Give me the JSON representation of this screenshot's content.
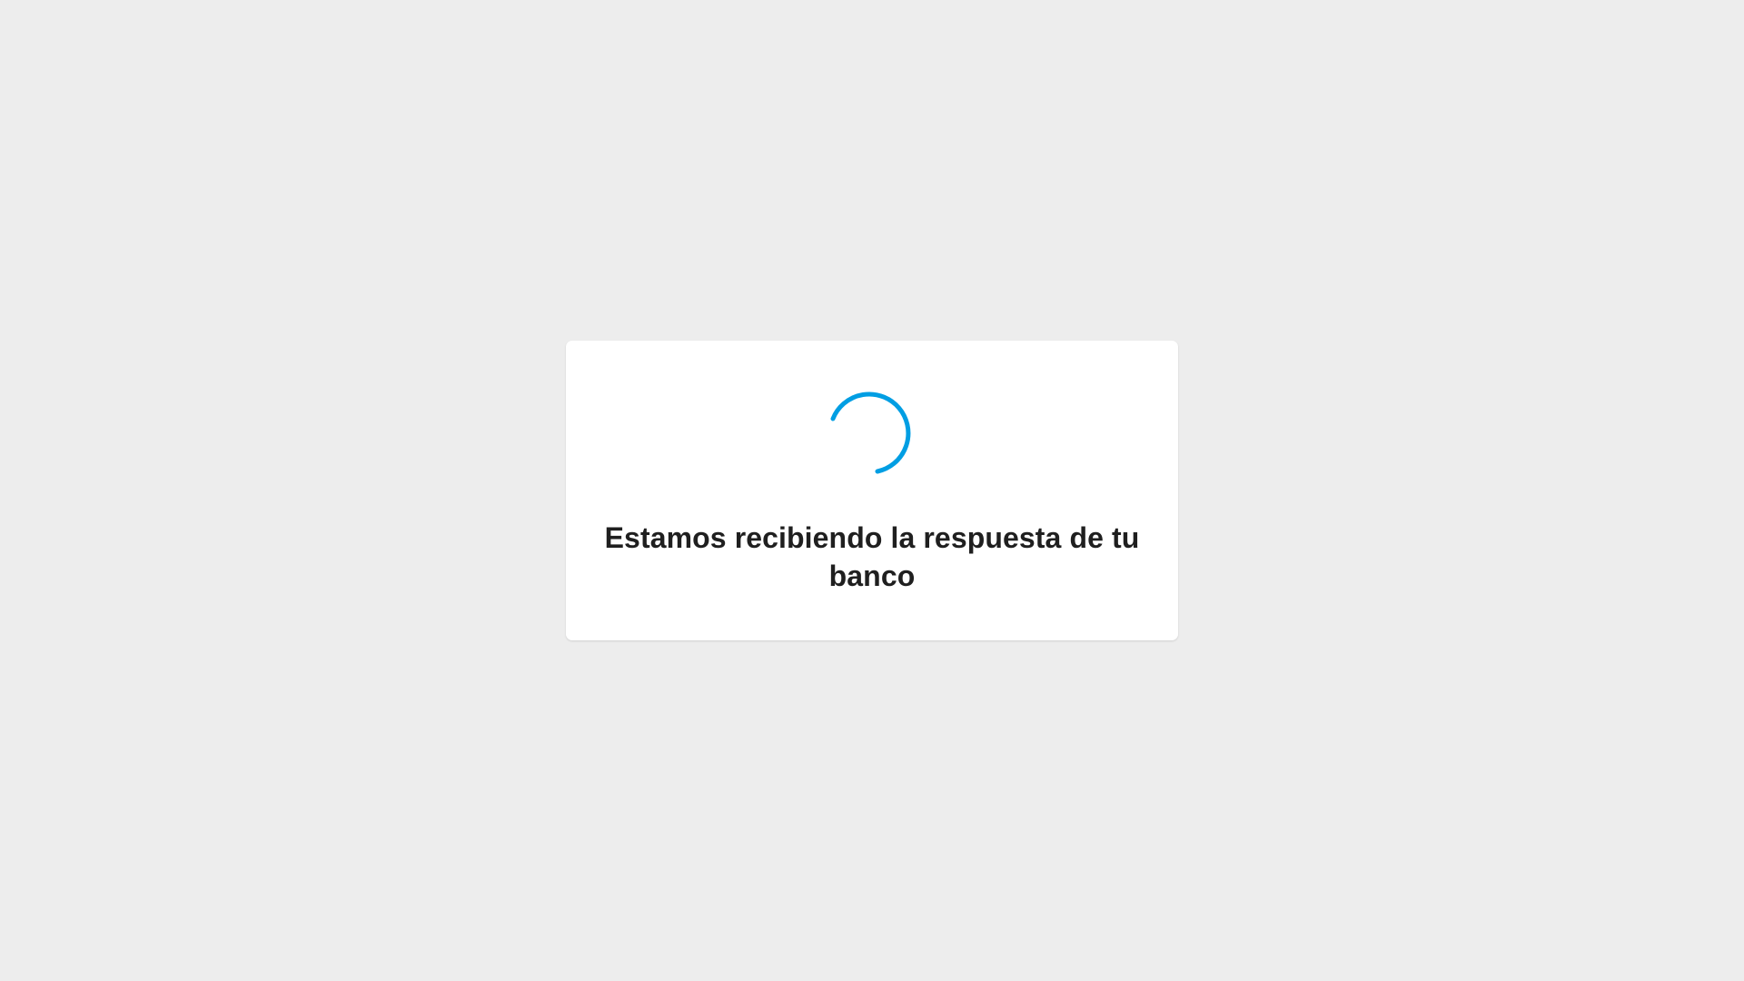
{
  "status": {
    "message": "Estamos recibiendo la respuesta de tu banco"
  },
  "colors": {
    "page_background": "#ededed",
    "card_background": "#ffffff",
    "spinner_accent": "#009ee3",
    "text_primary": "#1f1f1f"
  },
  "icons": {
    "loader": "loading-spinner-icon"
  }
}
